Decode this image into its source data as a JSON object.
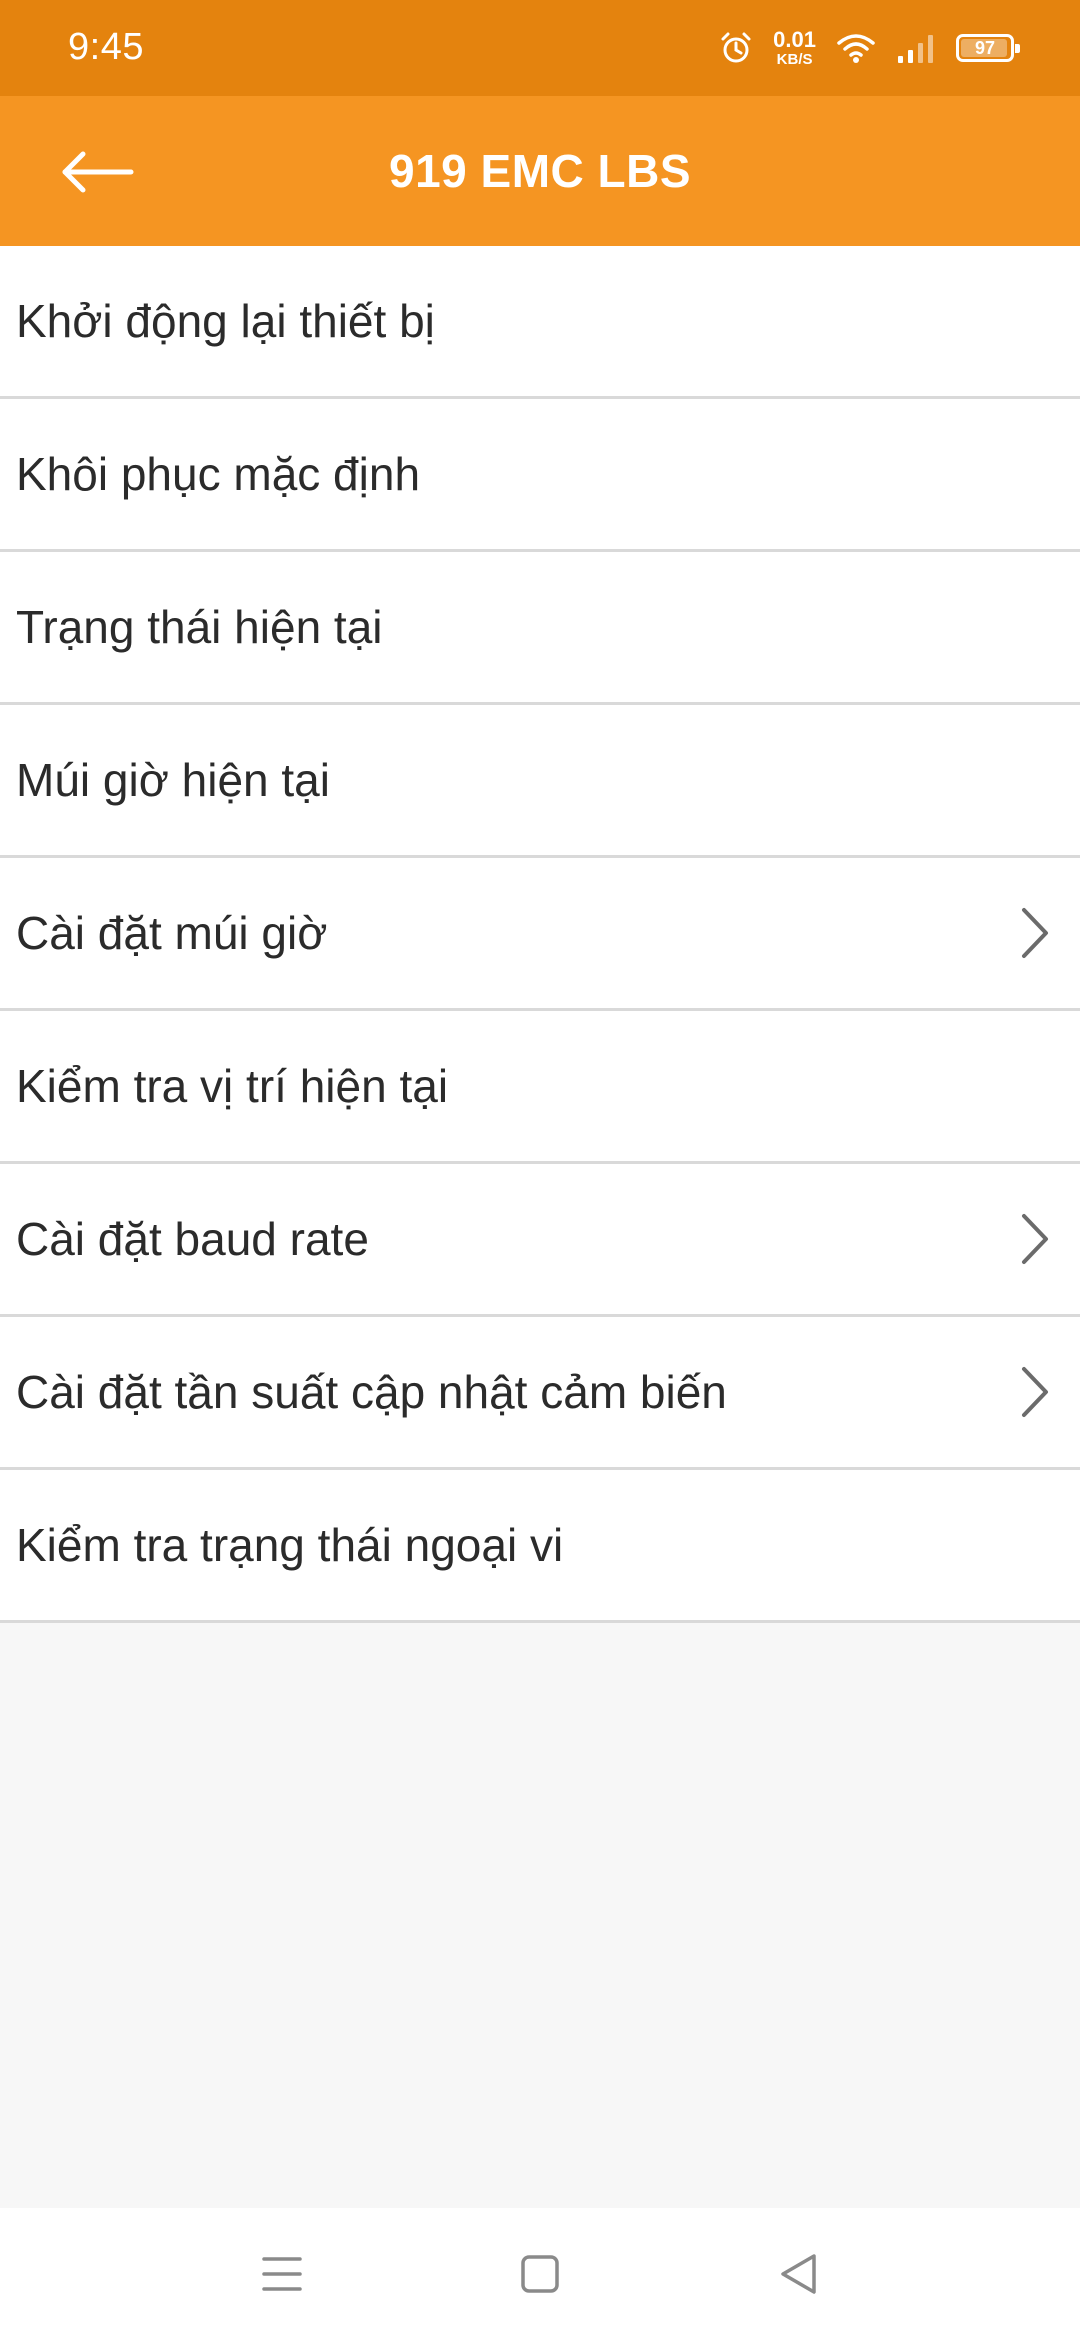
{
  "status_bar": {
    "time": "9:45",
    "net_speed_value": "0.01",
    "net_speed_unit": "KB/S",
    "battery_percent": "97",
    "battery_level": 0.97,
    "icons": [
      "alarm-icon",
      "wifi-icon",
      "signal-icon",
      "battery-icon"
    ]
  },
  "app_bar": {
    "title": "919 EMC LBS",
    "back_icon": "arrow-left-icon"
  },
  "menu": {
    "items": [
      {
        "label": "Khởi động lại thiết bị",
        "has_chevron": false
      },
      {
        "label": "Khôi phục mặc định",
        "has_chevron": false
      },
      {
        "label": "Trạng thái hiện tại",
        "has_chevron": false
      },
      {
        "label": "Múi giờ hiện tại",
        "has_chevron": false
      },
      {
        "label": "Cài đặt múi giờ",
        "has_chevron": true
      },
      {
        "label": "Kiểm tra vị trí hiện tại",
        "has_chevron": false
      },
      {
        "label": "Cài đặt baud rate",
        "has_chevron": true
      },
      {
        "label": "Cài đặt tần suất cập nhật cảm biến",
        "has_chevron": true
      },
      {
        "label": "Kiểm tra trạng thái ngoại vi",
        "has_chevron": false
      }
    ]
  },
  "nav_bar": {
    "icons": [
      "menu-icon",
      "home-icon",
      "back-triangle-icon"
    ]
  },
  "colors": {
    "status_bar": "#e4830e",
    "app_bar": "#f59522",
    "background": "#f7f7f7",
    "divider": "#d9d9d9",
    "text": "#2b2b2b",
    "chevron": "#6b6b6b"
  }
}
